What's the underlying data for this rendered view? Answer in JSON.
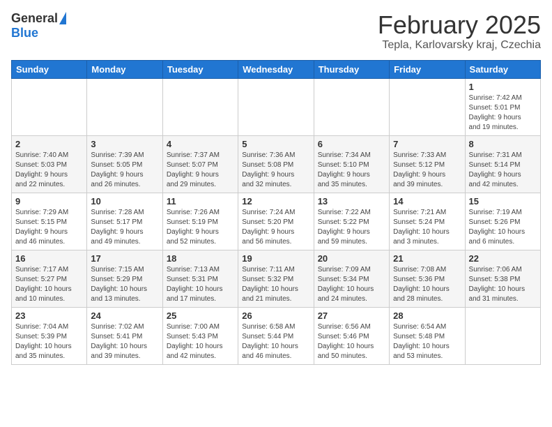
{
  "header": {
    "logo_general": "General",
    "logo_blue": "Blue",
    "title": "February 2025",
    "subtitle": "Tepla, Karlovarsky kraj, Czechia"
  },
  "calendar": {
    "days_of_week": [
      "Sunday",
      "Monday",
      "Tuesday",
      "Wednesday",
      "Thursday",
      "Friday",
      "Saturday"
    ],
    "weeks": [
      [
        {
          "day": "",
          "info": ""
        },
        {
          "day": "",
          "info": ""
        },
        {
          "day": "",
          "info": ""
        },
        {
          "day": "",
          "info": ""
        },
        {
          "day": "",
          "info": ""
        },
        {
          "day": "",
          "info": ""
        },
        {
          "day": "1",
          "info": "Sunrise: 7:42 AM\nSunset: 5:01 PM\nDaylight: 9 hours\nand 19 minutes."
        }
      ],
      [
        {
          "day": "2",
          "info": "Sunrise: 7:40 AM\nSunset: 5:03 PM\nDaylight: 9 hours\nand 22 minutes."
        },
        {
          "day": "3",
          "info": "Sunrise: 7:39 AM\nSunset: 5:05 PM\nDaylight: 9 hours\nand 26 minutes."
        },
        {
          "day": "4",
          "info": "Sunrise: 7:37 AM\nSunset: 5:07 PM\nDaylight: 9 hours\nand 29 minutes."
        },
        {
          "day": "5",
          "info": "Sunrise: 7:36 AM\nSunset: 5:08 PM\nDaylight: 9 hours\nand 32 minutes."
        },
        {
          "day": "6",
          "info": "Sunrise: 7:34 AM\nSunset: 5:10 PM\nDaylight: 9 hours\nand 35 minutes."
        },
        {
          "day": "7",
          "info": "Sunrise: 7:33 AM\nSunset: 5:12 PM\nDaylight: 9 hours\nand 39 minutes."
        },
        {
          "day": "8",
          "info": "Sunrise: 7:31 AM\nSunset: 5:14 PM\nDaylight: 9 hours\nand 42 minutes."
        }
      ],
      [
        {
          "day": "9",
          "info": "Sunrise: 7:29 AM\nSunset: 5:15 PM\nDaylight: 9 hours\nand 46 minutes."
        },
        {
          "day": "10",
          "info": "Sunrise: 7:28 AM\nSunset: 5:17 PM\nDaylight: 9 hours\nand 49 minutes."
        },
        {
          "day": "11",
          "info": "Sunrise: 7:26 AM\nSunset: 5:19 PM\nDaylight: 9 hours\nand 52 minutes."
        },
        {
          "day": "12",
          "info": "Sunrise: 7:24 AM\nSunset: 5:20 PM\nDaylight: 9 hours\nand 56 minutes."
        },
        {
          "day": "13",
          "info": "Sunrise: 7:22 AM\nSunset: 5:22 PM\nDaylight: 9 hours\nand 59 minutes."
        },
        {
          "day": "14",
          "info": "Sunrise: 7:21 AM\nSunset: 5:24 PM\nDaylight: 10 hours\nand 3 minutes."
        },
        {
          "day": "15",
          "info": "Sunrise: 7:19 AM\nSunset: 5:26 PM\nDaylight: 10 hours\nand 6 minutes."
        }
      ],
      [
        {
          "day": "16",
          "info": "Sunrise: 7:17 AM\nSunset: 5:27 PM\nDaylight: 10 hours\nand 10 minutes."
        },
        {
          "day": "17",
          "info": "Sunrise: 7:15 AM\nSunset: 5:29 PM\nDaylight: 10 hours\nand 13 minutes."
        },
        {
          "day": "18",
          "info": "Sunrise: 7:13 AM\nSunset: 5:31 PM\nDaylight: 10 hours\nand 17 minutes."
        },
        {
          "day": "19",
          "info": "Sunrise: 7:11 AM\nSunset: 5:32 PM\nDaylight: 10 hours\nand 21 minutes."
        },
        {
          "day": "20",
          "info": "Sunrise: 7:09 AM\nSunset: 5:34 PM\nDaylight: 10 hours\nand 24 minutes."
        },
        {
          "day": "21",
          "info": "Sunrise: 7:08 AM\nSunset: 5:36 PM\nDaylight: 10 hours\nand 28 minutes."
        },
        {
          "day": "22",
          "info": "Sunrise: 7:06 AM\nSunset: 5:38 PM\nDaylight: 10 hours\nand 31 minutes."
        }
      ],
      [
        {
          "day": "23",
          "info": "Sunrise: 7:04 AM\nSunset: 5:39 PM\nDaylight: 10 hours\nand 35 minutes."
        },
        {
          "day": "24",
          "info": "Sunrise: 7:02 AM\nSunset: 5:41 PM\nDaylight: 10 hours\nand 39 minutes."
        },
        {
          "day": "25",
          "info": "Sunrise: 7:00 AM\nSunset: 5:43 PM\nDaylight: 10 hours\nand 42 minutes."
        },
        {
          "day": "26",
          "info": "Sunrise: 6:58 AM\nSunset: 5:44 PM\nDaylight: 10 hours\nand 46 minutes."
        },
        {
          "day": "27",
          "info": "Sunrise: 6:56 AM\nSunset: 5:46 PM\nDaylight: 10 hours\nand 50 minutes."
        },
        {
          "day": "28",
          "info": "Sunrise: 6:54 AM\nSunset: 5:48 PM\nDaylight: 10 hours\nand 53 minutes."
        },
        {
          "day": "",
          "info": ""
        }
      ]
    ]
  }
}
